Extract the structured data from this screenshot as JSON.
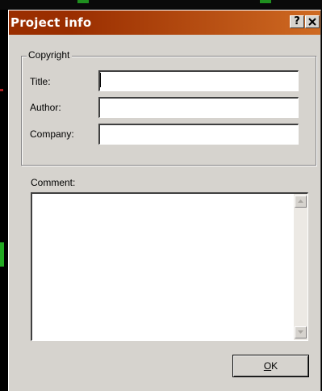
{
  "dialog": {
    "title": "Project info",
    "help_button": "?",
    "close_button": "✕"
  },
  "copyright_group": {
    "legend": "Copyright",
    "fields": [
      {
        "label": "Title:",
        "value": ""
      },
      {
        "label": "Author:",
        "value": ""
      },
      {
        "label": "Company:",
        "value": ""
      }
    ]
  },
  "comment": {
    "label": "Comment:",
    "value": ""
  },
  "ok_button": {
    "mnemonic": "O",
    "rest": "K"
  },
  "colors": {
    "titlebar_start": "#9a2e00",
    "titlebar_end": "#cf6a22",
    "dialog_face": "#d6d3ce"
  }
}
